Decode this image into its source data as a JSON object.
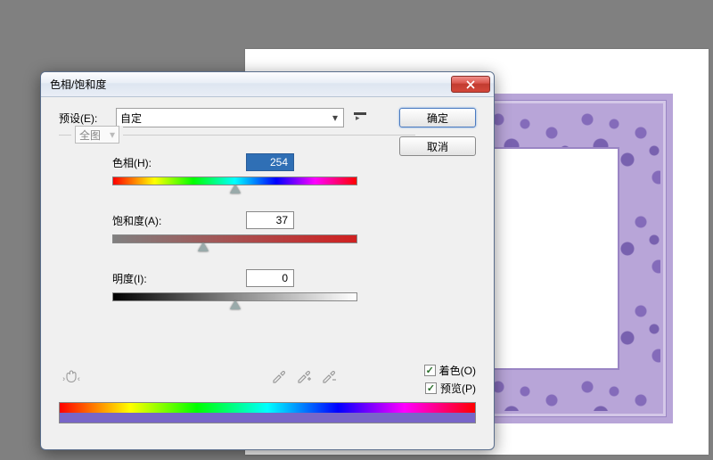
{
  "dialog": {
    "title": "色相/饱和度",
    "preset_label": "预设(E):",
    "preset_value": "自定",
    "channel_value": "全图",
    "ok_label": "确定",
    "cancel_label": "取消",
    "colorize_label": "着色(O)",
    "preview_label": "预览(P)"
  },
  "sliders": {
    "hue": {
      "label": "色相(H):",
      "value": "254",
      "thumb_pct": 50
    },
    "saturation": {
      "label": "饱和度(A):",
      "value": "37",
      "thumb_pct": 37
    },
    "lightness": {
      "label": "明度(I):",
      "value": "0",
      "thumb_pct": 50
    }
  },
  "checkmarks": {
    "colorize": "✓",
    "preview": "✓"
  }
}
